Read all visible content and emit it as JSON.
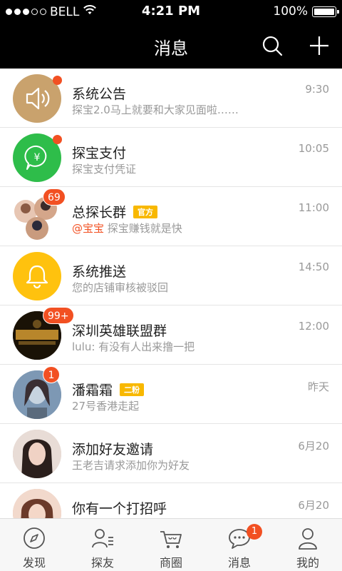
{
  "status_bar": {
    "carrier": "BELL",
    "time": "4:21 PM",
    "battery": "100%"
  },
  "nav": {
    "title": "消息",
    "search_icon": "search-icon",
    "add_icon": "plus-icon"
  },
  "colors": {
    "accent": "#f25022",
    "nav_bg": "#000000",
    "tag": "#f8b800",
    "announce_bg": "#c9a26d",
    "pay_bg": "#2ebd4a",
    "push_bg": "#ffc20e"
  },
  "messages": [
    {
      "title": "系统公告",
      "preview": "探宝2.0马上就要和大家见面啦……",
      "time": "9:30"
    },
    {
      "title": "探宝支付",
      "preview": "探宝支付凭证",
      "time": "10:05"
    },
    {
      "title": "总探长群",
      "tag": "官方",
      "badge": "69",
      "mention": "@宝宝",
      "preview": "探宝赚钱就是快",
      "time": "11:00"
    },
    {
      "title": "系统推送",
      "preview": "您的店铺审核被驳回",
      "time": "14:50"
    },
    {
      "title": "深圳英雄联盟群",
      "badge": "99+",
      "preview": "lulu: 有没有人出来撸一把",
      "time": "12:00"
    },
    {
      "title": "潘霜霜",
      "tag": "二粉",
      "badge": "1",
      "preview": "27号香港走起",
      "time": "昨天"
    },
    {
      "title": "添加好友邀请",
      "preview": "王老吉请求添加你为好友",
      "time": "6月20"
    },
    {
      "title": "你有一个打招呼",
      "preview": "",
      "time": "6月20"
    }
  ],
  "tabs": [
    {
      "label": "发现",
      "icon": "compass-icon"
    },
    {
      "label": "探友",
      "icon": "friends-icon"
    },
    {
      "label": "商圈",
      "icon": "shop-cart-icon"
    },
    {
      "label": "消息",
      "icon": "message-icon",
      "badge": "1"
    },
    {
      "label": "我的",
      "icon": "profile-icon"
    }
  ]
}
